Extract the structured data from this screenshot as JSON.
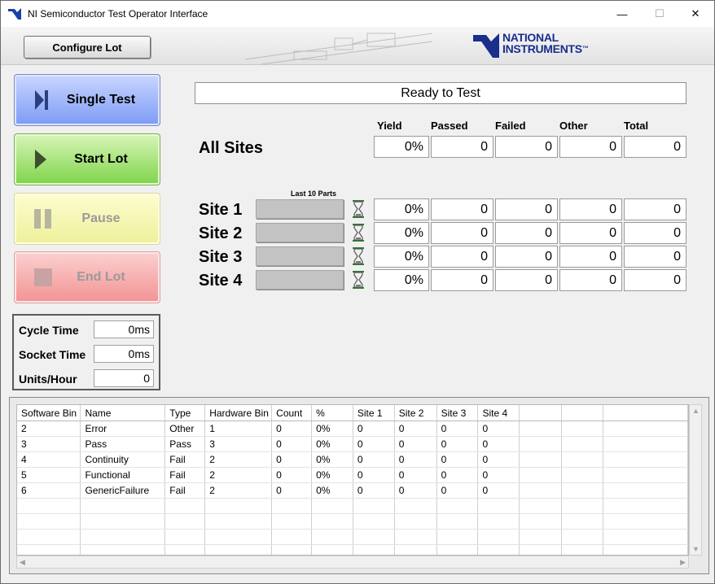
{
  "window": {
    "title": "NI Semiconductor Test Operator Interface",
    "minimize": "—",
    "maximize": "☐",
    "close": "✕"
  },
  "header": {
    "configure_lot_label": "Configure Lot",
    "logo_line1": "NATIONAL",
    "logo_line2": "INSTRUMENTS",
    "logo_tm": "™"
  },
  "controls": {
    "single_test": "Single Test",
    "start_lot": "Start Lot",
    "pause": "Pause",
    "end_lot": "End Lot"
  },
  "timing": [
    {
      "label": "Cycle Time",
      "value": "0ms"
    },
    {
      "label": "Socket Time",
      "value": "0ms"
    },
    {
      "label": "Units/Hour",
      "value": "0"
    }
  ],
  "status_text": "Ready to Test",
  "stats_headers": [
    "Yield",
    "Passed",
    "Failed",
    "Other",
    "Total"
  ],
  "all_sites": {
    "label": "All Sites",
    "values": [
      "0%",
      "0",
      "0",
      "0",
      "0"
    ]
  },
  "last10_label": "Last 10 Parts",
  "sites": [
    {
      "label": "Site 1",
      "values": [
        "0%",
        "0",
        "0",
        "0",
        "0"
      ]
    },
    {
      "label": "Site 2",
      "values": [
        "0%",
        "0",
        "0",
        "0",
        "0"
      ]
    },
    {
      "label": "Site 3",
      "values": [
        "0%",
        "0",
        "0",
        "0",
        "0"
      ]
    },
    {
      "label": "Site 4",
      "values": [
        "0%",
        "0",
        "0",
        "0",
        "0"
      ]
    }
  ],
  "bin_table": {
    "columns": [
      "Software Bin",
      "Name",
      "Type",
      "Hardware Bin",
      "Count",
      "%",
      "Site 1",
      "Site 2",
      "Site 3",
      "Site 4",
      "",
      "",
      ""
    ],
    "rows": [
      [
        "2",
        "Error",
        "Other",
        "1",
        "0",
        "0%",
        "0",
        "0",
        "0",
        "0",
        "",
        "",
        ""
      ],
      [
        "3",
        "Pass",
        "Pass",
        "3",
        "0",
        "0%",
        "0",
        "0",
        "0",
        "0",
        "",
        "",
        ""
      ],
      [
        "4",
        "Continuity",
        "Fail",
        "2",
        "0",
        "0%",
        "0",
        "0",
        "0",
        "0",
        "",
        "",
        ""
      ],
      [
        "5",
        "Functional",
        "Fail",
        "2",
        "0",
        "0%",
        "0",
        "0",
        "0",
        "0",
        "",
        "",
        ""
      ],
      [
        "6",
        "GenericFailure",
        "Fail",
        "2",
        "0",
        "0%",
        "0",
        "0",
        "0",
        "0",
        "",
        "",
        ""
      ],
      [
        "",
        "",
        "",
        "",
        "",
        "",
        "",
        "",
        "",
        "",
        "",
        "",
        ""
      ],
      [
        "",
        "",
        "",
        "",
        "",
        "",
        "",
        "",
        "",
        "",
        "",
        "",
        ""
      ],
      [
        "",
        "",
        "",
        "",
        "",
        "",
        "",
        "",
        "",
        "",
        "",
        "",
        ""
      ],
      [
        "",
        "",
        "",
        "",
        "",
        "",
        "",
        "",
        "",
        "",
        "",
        "",
        ""
      ]
    ]
  },
  "colors": {
    "ni_blue": "#1a2e8c",
    "hourglass_green": "#2e7d32"
  }
}
